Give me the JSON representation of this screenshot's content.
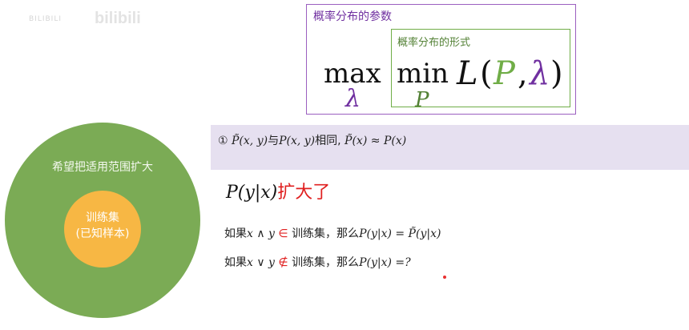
{
  "watermark": {
    "small": "BILIBILI",
    "logo": "bilibili"
  },
  "outer_box": {
    "label": "概率分布的参数",
    "color": "#7030a0"
  },
  "inner_box": {
    "label": "概率分布的形式",
    "color": "#538135"
  },
  "formula": {
    "max": "max",
    "max_sub": "λ",
    "min": "min",
    "min_sub": "P",
    "func": "L",
    "lparen": "(",
    "arg1": "P",
    "comma": ",",
    "arg2": "λ",
    "rparen": ")"
  },
  "note": {
    "num": "①",
    "p_tilde_xy": "P̃(x, y)",
    "same_as": "与",
    "p_xy": "P(x, y)",
    "same_text": "相同,",
    "p_tilde_x": "P̃(x)",
    "approx": "≈",
    "p_x": "P(x)"
  },
  "headline": {
    "math": "P(y|x)",
    "text": "扩大了"
  },
  "line1": {
    "prefix": "如果",
    "math_a": "x ∧ y",
    "symbol": "∈",
    "mid": "训练集，那么",
    "math_b": "P(y|x) = P̃(y|x)"
  },
  "line2": {
    "prefix": "如果",
    "math_a": "x ∨ y",
    "symbol": "∉",
    "mid": "训练集，那么",
    "math_b": "P(y|x) =?"
  },
  "circles": {
    "outer_label": "希望把适用范围扩大",
    "inner_label_1": "训练集",
    "inner_label_2": "(已知样本)",
    "outer_color": "#7bab55",
    "inner_color": "#f7b744"
  }
}
